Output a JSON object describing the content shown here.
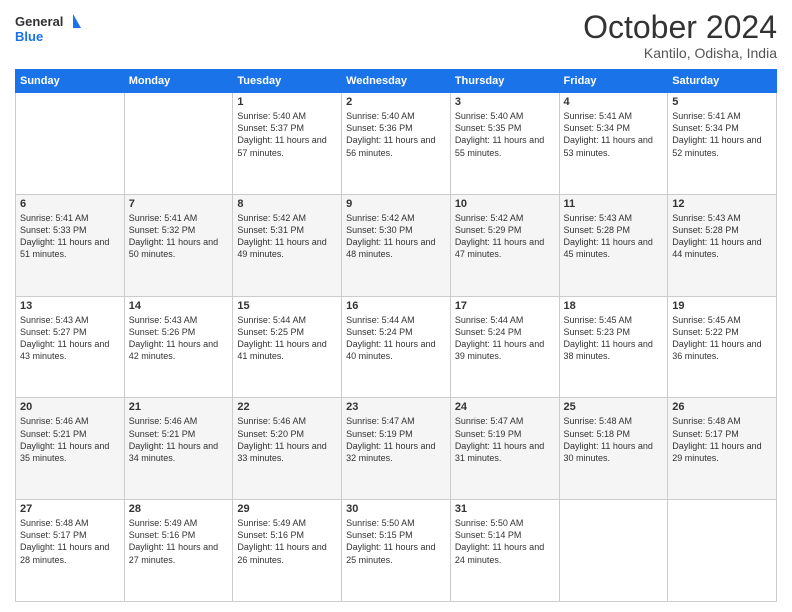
{
  "logo": {
    "line1": "General",
    "line2": "Blue"
  },
  "title": "October 2024",
  "subtitle": "Kantilo, Odisha, India",
  "days_of_week": [
    "Sunday",
    "Monday",
    "Tuesday",
    "Wednesday",
    "Thursday",
    "Friday",
    "Saturday"
  ],
  "weeks": [
    [
      {
        "day": "",
        "info": ""
      },
      {
        "day": "",
        "info": ""
      },
      {
        "day": "1",
        "info": "Sunrise: 5:40 AM\nSunset: 5:37 PM\nDaylight: 11 hours and 57 minutes."
      },
      {
        "day": "2",
        "info": "Sunrise: 5:40 AM\nSunset: 5:36 PM\nDaylight: 11 hours and 56 minutes."
      },
      {
        "day": "3",
        "info": "Sunrise: 5:40 AM\nSunset: 5:35 PM\nDaylight: 11 hours and 55 minutes."
      },
      {
        "day": "4",
        "info": "Sunrise: 5:41 AM\nSunset: 5:34 PM\nDaylight: 11 hours and 53 minutes."
      },
      {
        "day": "5",
        "info": "Sunrise: 5:41 AM\nSunset: 5:34 PM\nDaylight: 11 hours and 52 minutes."
      }
    ],
    [
      {
        "day": "6",
        "info": "Sunrise: 5:41 AM\nSunset: 5:33 PM\nDaylight: 11 hours and 51 minutes."
      },
      {
        "day": "7",
        "info": "Sunrise: 5:41 AM\nSunset: 5:32 PM\nDaylight: 11 hours and 50 minutes."
      },
      {
        "day": "8",
        "info": "Sunrise: 5:42 AM\nSunset: 5:31 PM\nDaylight: 11 hours and 49 minutes."
      },
      {
        "day": "9",
        "info": "Sunrise: 5:42 AM\nSunset: 5:30 PM\nDaylight: 11 hours and 48 minutes."
      },
      {
        "day": "10",
        "info": "Sunrise: 5:42 AM\nSunset: 5:29 PM\nDaylight: 11 hours and 47 minutes."
      },
      {
        "day": "11",
        "info": "Sunrise: 5:43 AM\nSunset: 5:28 PM\nDaylight: 11 hours and 45 minutes."
      },
      {
        "day": "12",
        "info": "Sunrise: 5:43 AM\nSunset: 5:28 PM\nDaylight: 11 hours and 44 minutes."
      }
    ],
    [
      {
        "day": "13",
        "info": "Sunrise: 5:43 AM\nSunset: 5:27 PM\nDaylight: 11 hours and 43 minutes."
      },
      {
        "day": "14",
        "info": "Sunrise: 5:43 AM\nSunset: 5:26 PM\nDaylight: 11 hours and 42 minutes."
      },
      {
        "day": "15",
        "info": "Sunrise: 5:44 AM\nSunset: 5:25 PM\nDaylight: 11 hours and 41 minutes."
      },
      {
        "day": "16",
        "info": "Sunrise: 5:44 AM\nSunset: 5:24 PM\nDaylight: 11 hours and 40 minutes."
      },
      {
        "day": "17",
        "info": "Sunrise: 5:44 AM\nSunset: 5:24 PM\nDaylight: 11 hours and 39 minutes."
      },
      {
        "day": "18",
        "info": "Sunrise: 5:45 AM\nSunset: 5:23 PM\nDaylight: 11 hours and 38 minutes."
      },
      {
        "day": "19",
        "info": "Sunrise: 5:45 AM\nSunset: 5:22 PM\nDaylight: 11 hours and 36 minutes."
      }
    ],
    [
      {
        "day": "20",
        "info": "Sunrise: 5:46 AM\nSunset: 5:21 PM\nDaylight: 11 hours and 35 minutes."
      },
      {
        "day": "21",
        "info": "Sunrise: 5:46 AM\nSunset: 5:21 PM\nDaylight: 11 hours and 34 minutes."
      },
      {
        "day": "22",
        "info": "Sunrise: 5:46 AM\nSunset: 5:20 PM\nDaylight: 11 hours and 33 minutes."
      },
      {
        "day": "23",
        "info": "Sunrise: 5:47 AM\nSunset: 5:19 PM\nDaylight: 11 hours and 32 minutes."
      },
      {
        "day": "24",
        "info": "Sunrise: 5:47 AM\nSunset: 5:19 PM\nDaylight: 11 hours and 31 minutes."
      },
      {
        "day": "25",
        "info": "Sunrise: 5:48 AM\nSunset: 5:18 PM\nDaylight: 11 hours and 30 minutes."
      },
      {
        "day": "26",
        "info": "Sunrise: 5:48 AM\nSunset: 5:17 PM\nDaylight: 11 hours and 29 minutes."
      }
    ],
    [
      {
        "day": "27",
        "info": "Sunrise: 5:48 AM\nSunset: 5:17 PM\nDaylight: 11 hours and 28 minutes."
      },
      {
        "day": "28",
        "info": "Sunrise: 5:49 AM\nSunset: 5:16 PM\nDaylight: 11 hours and 27 minutes."
      },
      {
        "day": "29",
        "info": "Sunrise: 5:49 AM\nSunset: 5:16 PM\nDaylight: 11 hours and 26 minutes."
      },
      {
        "day": "30",
        "info": "Sunrise: 5:50 AM\nSunset: 5:15 PM\nDaylight: 11 hours and 25 minutes."
      },
      {
        "day": "31",
        "info": "Sunrise: 5:50 AM\nSunset: 5:14 PM\nDaylight: 11 hours and 24 minutes."
      },
      {
        "day": "",
        "info": ""
      },
      {
        "day": "",
        "info": ""
      }
    ]
  ]
}
